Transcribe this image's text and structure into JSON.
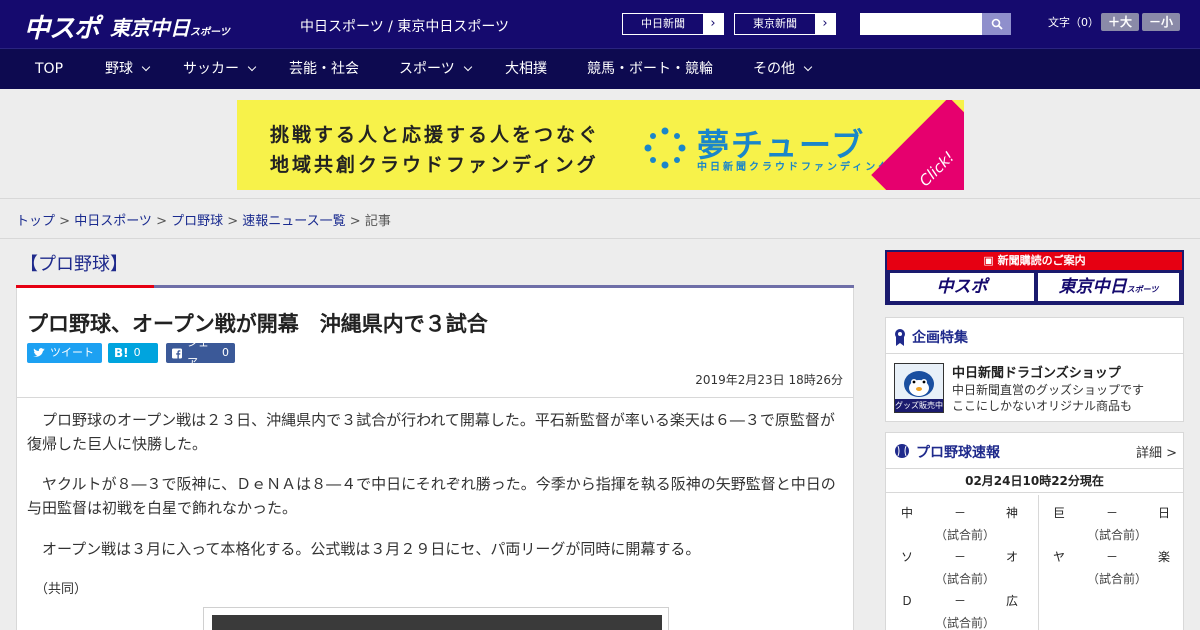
{
  "header": {
    "logo_chunichi": "中スポ",
    "logo_tokyo": "東京中日",
    "logo_tokyo_sub": "スポーツ",
    "site_links": "中日スポーツ / 東京中日スポーツ",
    "paper_buttons": [
      "中日新聞",
      "東京新聞"
    ],
    "search_placeholder": "",
    "font_size_label": "文字（0）",
    "font_larger": "＋大",
    "font_smaller": "－小"
  },
  "nav": {
    "items": [
      {
        "label": "TOP",
        "has_menu": false
      },
      {
        "label": "野球",
        "has_menu": true
      },
      {
        "label": "サッカー",
        "has_menu": true
      },
      {
        "label": "芸能・社会",
        "has_menu": false
      },
      {
        "label": "スポーツ",
        "has_menu": true
      },
      {
        "label": "大相撲",
        "has_menu": false
      },
      {
        "label": "競馬・ボート・競輪",
        "has_menu": false
      },
      {
        "label": "その他",
        "has_menu": true
      }
    ]
  },
  "banner": {
    "line1": "挑戦する人と応援する人をつなぐ",
    "line2": "地域共創クラウドファンディング",
    "brand": "夢チューブ",
    "brand_sub": "中日新聞クラウドファンディング",
    "click": "Click!"
  },
  "breadcrumb": {
    "items": [
      "トップ",
      "中日スポーツ",
      "プロ野球",
      "速報ニュース一覧"
    ],
    "current": "記事"
  },
  "article": {
    "category": "【プロ野球】",
    "headline": "プロ野球、オープン戦が開幕　沖縄県内で３試合",
    "share": {
      "tweet": "ツイート",
      "hatena_count": "0",
      "facebook": "シェア",
      "facebook_count": "0"
    },
    "date": "2019年2月23日 18時26分",
    "paragraphs": [
      "プロ野球のオープン戦は２３日、沖縄県内で３試合が行われて開幕した。平石新監督が率いる楽天は６―３で原監督が復帰した巨人に快勝した。",
      "ヤクルトが８―３で阪神に、ＤｅＮＡは８―４で中日にそれぞれ勝った。今季から指揮を執る阪神の矢野監督と中日の与田監督は初戦を白星で飾れなかった。",
      "オープン戦は３月に入って本格化する。公式戦は３月２９日にセ、パ両リーグが同時に開幕する。"
    ],
    "credit": "（共同）"
  },
  "sidebar": {
    "subscribe_title": "新聞購読のご案内",
    "subscribe_buttons": [
      "中スポ",
      "東京中日"
    ],
    "subscribe_sub": "スポーツ",
    "feature_title": "企画特集",
    "shop": {
      "badge": "グッズ販売中",
      "title": "中日新聞ドラゴンズショップ",
      "desc1": "中日新聞直営のグッズショップです",
      "desc2": "ここにしかないオリジナル商品も"
    },
    "scores_title": "プロ野球速報",
    "scores_detail": "詳細 >",
    "scores_asof": "02月24日10時22分現在",
    "games_left": [
      {
        "home": "中",
        "sep": "－",
        "away": "神",
        "status": "（試合前）"
      },
      {
        "home": "ソ",
        "sep": "－",
        "away": "オ",
        "status": "（試合前）"
      },
      {
        "home": "Ｄ",
        "sep": "－",
        "away": "広",
        "status": "（試合前）"
      }
    ],
    "games_right": [
      {
        "home": "巨",
        "sep": "－",
        "away": "日",
        "status": "（試合前）"
      },
      {
        "home": "ヤ",
        "sep": "－",
        "away": "楽",
        "status": "（試合前）"
      }
    ]
  },
  "colors": {
    "header_bg": "#150a6e",
    "nav_bg": "#0d0a50",
    "accent_red": "#e60012",
    "link_blue": "#1a2b8f",
    "banner_yellow": "#f7f24a",
    "banner_blue": "#1a86c9"
  }
}
